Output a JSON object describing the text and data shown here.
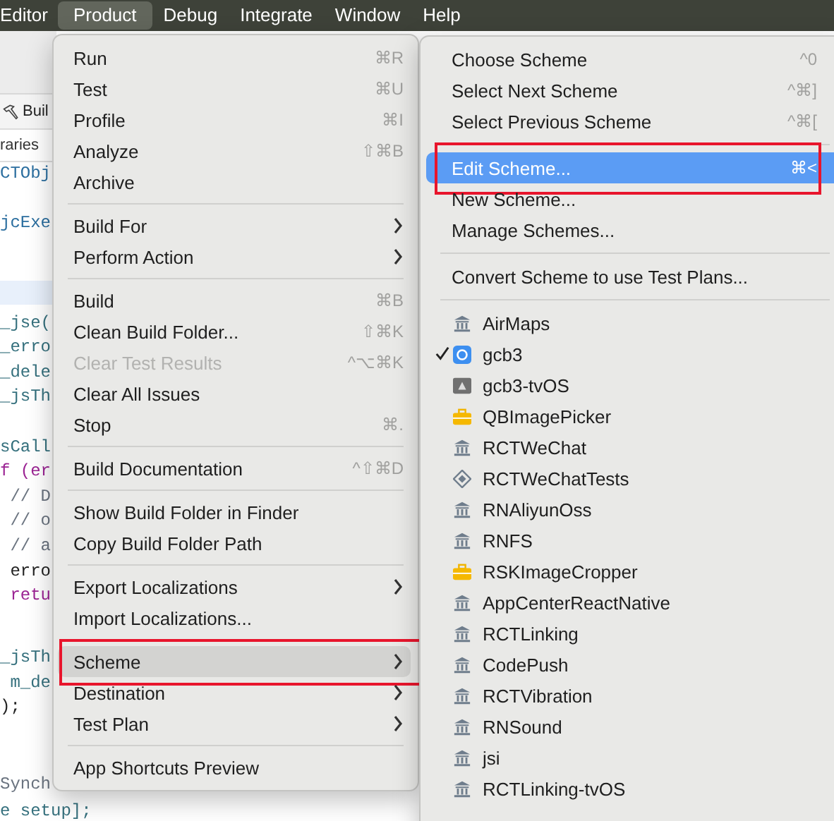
{
  "menu_bar": [
    {
      "label": "Editor",
      "selected": false
    },
    {
      "label": "Product",
      "selected": true
    },
    {
      "label": "Debug",
      "selected": false
    },
    {
      "label": "Integrate",
      "selected": false
    },
    {
      "label": "Window",
      "selected": false
    },
    {
      "label": "Help",
      "selected": false
    }
  ],
  "editor": {
    "tab": "Buil",
    "path": "raries",
    "code_lines": [
      {
        "text": "CTObj",
        "kind": "type"
      },
      {
        "text": "jcExe",
        "kind": "type"
      },
      {
        "text": "_jse(",
        "kind": "ident"
      },
      {
        "text": "_erro",
        "kind": "ident"
      },
      {
        "text": "_dele",
        "kind": "ident"
      },
      {
        "text": "_jsTh",
        "kind": "ident"
      },
      {
        "text": "sCall",
        "kind": "ident"
      },
      {
        "text": "f (er",
        "kind": "keyword"
      },
      {
        "text": " // D",
        "kind": "comment"
      },
      {
        "text": " // o",
        "kind": "comment"
      },
      {
        "text": " // a",
        "kind": "comment"
      },
      {
        "text": " erro",
        "kind": "plain"
      },
      {
        "text": " retu",
        "kind": "keyword"
      },
      {
        "text": "_jsTh",
        "kind": "ident"
      },
      {
        "text": " m_de",
        "kind": "ident"
      },
      {
        "text": ");",
        "kind": "plain"
      },
      {
        "text": "Synch",
        "kind": "comment"
      },
      {
        "text": "e setup];",
        "kind": "ident"
      }
    ]
  },
  "product_menu": {
    "sections": [
      [
        {
          "label": "Run",
          "shortcut": "⌘R",
          "disabled": false,
          "submenu": false,
          "selected": false,
          "highlighted": false
        },
        {
          "label": "Test",
          "shortcut": "⌘U",
          "disabled": false,
          "submenu": false,
          "selected": false,
          "highlighted": false
        },
        {
          "label": "Profile",
          "shortcut": "⌘I",
          "disabled": false,
          "submenu": false,
          "selected": false,
          "highlighted": false
        },
        {
          "label": "Analyze",
          "shortcut": "⇧⌘B",
          "disabled": false,
          "submenu": false,
          "selected": false,
          "highlighted": false
        },
        {
          "label": "Archive",
          "disabled": false,
          "submenu": false,
          "selected": false,
          "highlighted": false
        }
      ],
      [
        {
          "label": "Build For",
          "disabled": false,
          "submenu": true,
          "selected": false,
          "highlighted": false
        },
        {
          "label": "Perform Action",
          "disabled": false,
          "submenu": true,
          "selected": false,
          "highlighted": false
        }
      ],
      [
        {
          "label": "Build",
          "shortcut": "⌘B",
          "disabled": false,
          "submenu": false,
          "selected": false,
          "highlighted": false
        },
        {
          "label": "Clean Build Folder...",
          "shortcut": "⇧⌘K",
          "disabled": false,
          "submenu": false,
          "selected": false,
          "highlighted": false
        },
        {
          "label": "Clear Test Results",
          "shortcut": "^⌥⌘K",
          "disabled": true,
          "submenu": false,
          "selected": false,
          "highlighted": false
        },
        {
          "label": "Clear All Issues",
          "disabled": false,
          "submenu": false,
          "selected": false,
          "highlighted": false
        },
        {
          "label": "Stop",
          "shortcut": "⌘.",
          "disabled": false,
          "submenu": false,
          "selected": false,
          "highlighted": false
        }
      ],
      [
        {
          "label": "Build Documentation",
          "shortcut": "^⇧⌘D",
          "disabled": false,
          "submenu": false,
          "selected": false,
          "highlighted": false
        }
      ],
      [
        {
          "label": "Show Build Folder in Finder",
          "disabled": false,
          "submenu": false,
          "selected": false,
          "highlighted": false
        },
        {
          "label": "Copy Build Folder Path",
          "disabled": false,
          "submenu": false,
          "selected": false,
          "highlighted": false
        }
      ],
      [
        {
          "label": "Export Localizations",
          "disabled": false,
          "submenu": true,
          "selected": false,
          "highlighted": false
        },
        {
          "label": "Import Localizations...",
          "disabled": false,
          "submenu": false,
          "selected": false,
          "highlighted": false
        }
      ],
      [
        {
          "label": "Scheme",
          "disabled": false,
          "submenu": true,
          "selected": true,
          "highlighted": true
        },
        {
          "label": "Destination",
          "disabled": false,
          "submenu": true,
          "selected": false,
          "highlighted": false
        },
        {
          "label": "Test Plan",
          "disabled": false,
          "submenu": true,
          "selected": false,
          "highlighted": false
        }
      ],
      [
        {
          "label": "App Shortcuts Preview",
          "disabled": false,
          "submenu": false,
          "selected": false,
          "highlighted": false
        }
      ]
    ]
  },
  "scheme_menu": {
    "sections": [
      [
        {
          "label": "Choose Scheme",
          "shortcut": "^0",
          "selected": false,
          "highlighted": false
        },
        {
          "label": "Select Next Scheme",
          "shortcut": "^⌘]",
          "selected": false,
          "highlighted": false
        },
        {
          "label": "Select Previous Scheme",
          "shortcut": "^⌘[",
          "selected": false,
          "highlighted": false
        }
      ],
      [
        {
          "label": "Edit Scheme...",
          "shortcut": "⌘<",
          "selected": true,
          "highlighted": true
        },
        {
          "label": "New Scheme...",
          "selected": false,
          "highlighted": false
        },
        {
          "label": "Manage Schemes...",
          "selected": false,
          "highlighted": false
        }
      ],
      [
        {
          "label": "Convert Scheme to use Test Plans...",
          "selected": false,
          "highlighted": false
        }
      ]
    ],
    "schemes": [
      {
        "label": "AirMaps",
        "kind": "library",
        "checked": false
      },
      {
        "label": "gcb3",
        "kind": "app",
        "checked": true
      },
      {
        "label": "gcb3-tvOS",
        "kind": "tvos",
        "checked": false
      },
      {
        "label": "QBImagePicker",
        "kind": "framework",
        "checked": false
      },
      {
        "label": "RCTWeChat",
        "kind": "library",
        "checked": false
      },
      {
        "label": "RCTWeChatTests",
        "kind": "test",
        "checked": false
      },
      {
        "label": "RNAliyunOss",
        "kind": "library",
        "checked": false
      },
      {
        "label": "RNFS",
        "kind": "library",
        "checked": false
      },
      {
        "label": "RSKImageCropper",
        "kind": "framework",
        "checked": false
      },
      {
        "label": "AppCenterReactNative",
        "kind": "library",
        "checked": false
      },
      {
        "label": "RCTLinking",
        "kind": "library",
        "checked": false
      },
      {
        "label": "CodePush",
        "kind": "library",
        "checked": false
      },
      {
        "label": "RCTVibration",
        "kind": "library",
        "checked": false
      },
      {
        "label": "RNSound",
        "kind": "library",
        "checked": false
      },
      {
        "label": "jsi",
        "kind": "library",
        "checked": false
      },
      {
        "label": "RCTLinking-tvOS",
        "kind": "library",
        "checked": false
      }
    ]
  }
}
